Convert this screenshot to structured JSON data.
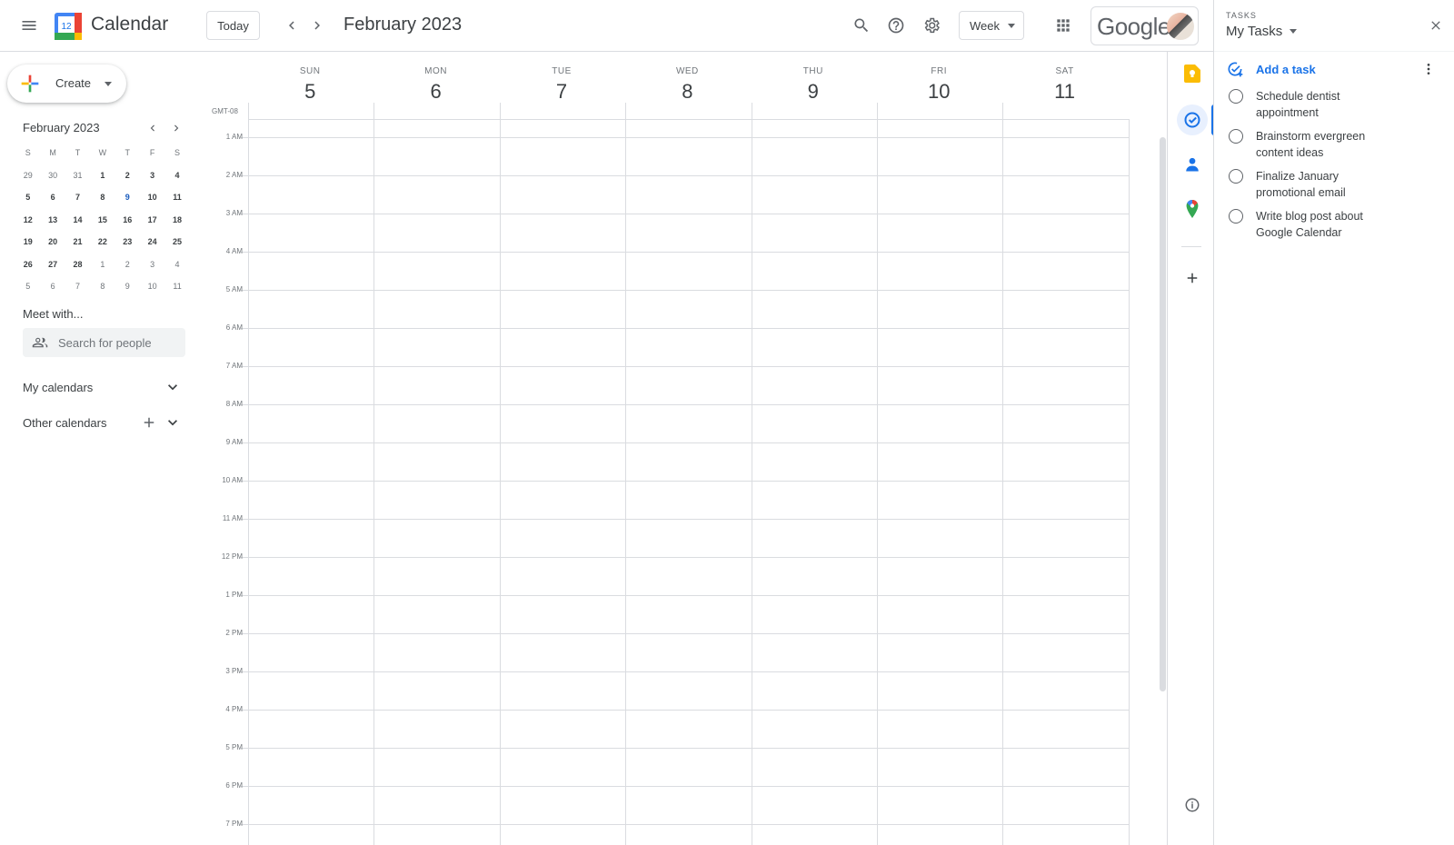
{
  "app": {
    "title": "Calendar",
    "logo_day": "12",
    "today_label": "Today",
    "current_range": "February 2023",
    "view_label": "Week",
    "account_brand": "Google"
  },
  "colors": {
    "accent": "#1a73e8",
    "border": "#dadce0",
    "selected_day_bg": "#c6dafc",
    "logo_yellow": "#fbbc04",
    "logo_green": "#34a853",
    "logo_red": "#ea4335",
    "logo_blue": "#4285f4"
  },
  "sidebar": {
    "create_label": "Create",
    "mini_month": "February 2023",
    "weekday_initials": [
      "S",
      "M",
      "T",
      "W",
      "T",
      "F",
      "S"
    ],
    "weeks": [
      [
        "29",
        "30",
        "31",
        "1",
        "2",
        "3",
        "4"
      ],
      [
        "5",
        "6",
        "7",
        "8",
        "9",
        "10",
        "11"
      ],
      [
        "12",
        "13",
        "14",
        "15",
        "16",
        "17",
        "18"
      ],
      [
        "19",
        "20",
        "21",
        "22",
        "23",
        "24",
        "25"
      ],
      [
        "26",
        "27",
        "28",
        "1",
        "2",
        "3",
        "4"
      ],
      [
        "5",
        "6",
        "7",
        "8",
        "9",
        "10",
        "11"
      ]
    ],
    "selected_day": "9",
    "meet_title": "Meet with...",
    "people_placeholder": "Search for people",
    "my_calendars": "My calendars",
    "other_calendars": "Other calendars"
  },
  "week": {
    "timezone": "GMT-08",
    "days": [
      {
        "name": "SUN",
        "num": "5"
      },
      {
        "name": "MON",
        "num": "6"
      },
      {
        "name": "TUE",
        "num": "7"
      },
      {
        "name": "WED",
        "num": "8"
      },
      {
        "name": "THU",
        "num": "9"
      },
      {
        "name": "FRI",
        "num": "10"
      },
      {
        "name": "SAT",
        "num": "11"
      }
    ],
    "hours": [
      "1 AM",
      "2 AM",
      "3 AM",
      "4 AM",
      "5 AM",
      "6 AM",
      "7 AM",
      "8 AM",
      "9 AM",
      "10 AM",
      "11 AM",
      "12 PM",
      "1 PM",
      "2 PM",
      "3 PM",
      "4 PM",
      "5 PM",
      "6 PM",
      "7 PM"
    ]
  },
  "rail_icons": [
    "keep-icon",
    "tasks-icon",
    "contacts-icon",
    "maps-icon",
    "add-addon-icon",
    "info-icon"
  ],
  "tasks": {
    "section_label": "TASKS",
    "list_name": "My Tasks",
    "add_label": "Add a task",
    "items": [
      {
        "line1": "Schedule dentist",
        "line2": "appointment"
      },
      {
        "line1": "Brainstorm evergreen",
        "line2": "content ideas"
      },
      {
        "line1": "Finalize January",
        "line2": "promotional email"
      },
      {
        "line1": "Write blog post about",
        "line2": "Google Calendar"
      }
    ]
  }
}
